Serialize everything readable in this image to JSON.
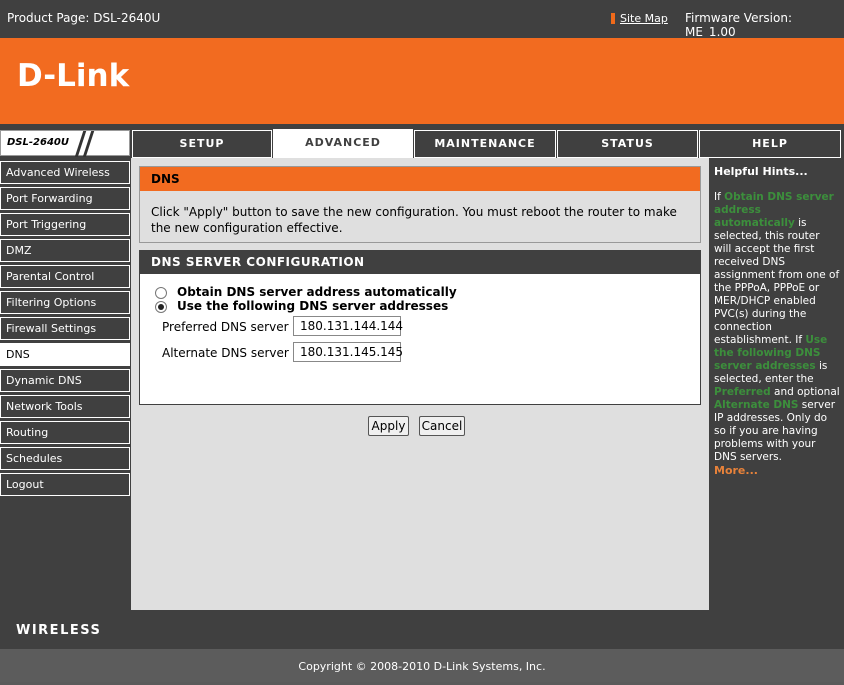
{
  "topbar": {
    "product": "Product Page: DSL-2640U",
    "site_map": "Site Map",
    "firmware": "Firmware Version: ME_1.00"
  },
  "brand": {
    "logo_text": "D-Link",
    "model": "DSL-2640U",
    "accent_color": "#f26b20"
  },
  "tabs": [
    {
      "label": "SETUP"
    },
    {
      "label": "ADVANCED"
    },
    {
      "label": "MAINTENANCE"
    },
    {
      "label": "STATUS"
    },
    {
      "label": "HELP"
    }
  ],
  "active_tab": "ADVANCED",
  "sidebar": {
    "items": [
      {
        "label": "Advanced Wireless"
      },
      {
        "label": "Port Forwarding"
      },
      {
        "label": "Port Triggering"
      },
      {
        "label": "DMZ"
      },
      {
        "label": "Parental Control"
      },
      {
        "label": "Filtering Options"
      },
      {
        "label": "Firewall Settings"
      },
      {
        "label": "DNS"
      },
      {
        "label": "Dynamic DNS"
      },
      {
        "label": "Network Tools"
      },
      {
        "label": "Routing"
      },
      {
        "label": "Schedules"
      },
      {
        "label": "Logout"
      }
    ],
    "active": "DNS"
  },
  "dns_intro": {
    "title": "DNS",
    "message": "Click \"Apply\" button to save the new configuration. You must reboot the router to make the new configuration effective."
  },
  "dns_config": {
    "title": "DNS SERVER CONFIGURATION",
    "option_auto": "Obtain DNS server address automatically",
    "option_manual": "Use the following DNS server addresses",
    "selected": "manual",
    "preferred_label": "Preferred DNS server :",
    "preferred_value": "180.131.144.144",
    "alternate_label": "Alternate DNS server :",
    "alternate_value": "180.131.145.145"
  },
  "buttons": {
    "apply": "Apply",
    "cancel": "Cancel"
  },
  "hints": {
    "title": "Helpful Hints...",
    "p1_prefix": "If ",
    "p1_hl1": "Obtain DNS server address automatically",
    "p1_mid": " is selected, this router will accept the first received DNS assignment from one of the PPPoA, PPPoE or MER/DHCP enabled PVC(s) during the connection establishment. If ",
    "p1_hl2": "Use the following DNS server addresses",
    "p1_mid2": " is selected, enter the ",
    "p1_hl3": "Preferred",
    "p1_mid3": " and optional ",
    "p1_hl4": "Alternate DNS",
    "p1_end": " server IP addresses. Only do so if you are having problems with your DNS servers.",
    "more": "More..."
  },
  "wireless_label": "WIRELESS",
  "footer": "Copyright © 2008-2010 D-Link Systems, Inc."
}
